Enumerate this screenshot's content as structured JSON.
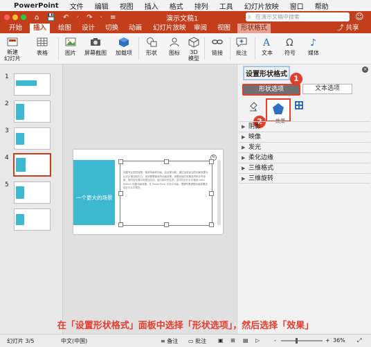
{
  "menubar": {
    "apple": "",
    "app": "PowerPoint",
    "items": [
      "文件",
      "编辑",
      "视图",
      "插入",
      "格式",
      "排列",
      "工具",
      "幻灯片放映",
      "窗口",
      "帮助"
    ]
  },
  "titlebar": {
    "title": "演示文稿1",
    "search_placeholder": "在演示文稿中搜索",
    "quick_access": "⌂ 💾 ↶ · ↷ · ≡"
  },
  "ribbon_tabs": [
    "开始",
    "插入",
    "绘图",
    "设计",
    "切换",
    "动画",
    "幻灯片放映",
    "审阅",
    "视图",
    "形状格式"
  ],
  "share_label": "共享",
  "ribbon": {
    "new_slide": "新建\n幻灯片",
    "table": "表格",
    "picture": "图片",
    "screenshot": "屏幕截图",
    "addins": "加载项",
    "shapes": "形状",
    "icons": "图标",
    "model3d": "3D\n模型",
    "link": "链接",
    "comment": "批注",
    "text": "文本",
    "symbol": "符号",
    "media": "媒体"
  },
  "slides": [
    {
      "num": "1"
    },
    {
      "num": "2"
    },
    {
      "num": "3"
    },
    {
      "num": "4"
    },
    {
      "num": "5"
    }
  ],
  "slide": {
    "title": "一个更大的场景",
    "body": "创建专业视觉效果，使用场景和动画、后台等功能，通过运用适当的动画效果为幻灯片增加吸引力。找到需要使用的动画效果。设置动画的效果选项和计时参数，使内容在展示时更加生动，吸引观众的注意。尝试在幻灯片中使用 After Effects 创建动画效果。在 PowerPoint 中设计动画。根据所需调整动画效果并在幻灯片中预览。"
  },
  "panel": {
    "title": "设置形状格式",
    "tab_shape": "形状选项",
    "tab_text": "文本选项",
    "effects_label": "效果",
    "sections": [
      "阴影",
      "映像",
      "发光",
      "柔化边缘",
      "三维格式",
      "三维旋转"
    ]
  },
  "badges": {
    "one": "1",
    "two": "2"
  },
  "status": {
    "slide": "幻灯片 3/5",
    "lang": "中文(中国)",
    "notes": "备注",
    "comments": "批注",
    "zoom": "36%",
    "zoom_minus": "-",
    "zoom_plus": "+"
  },
  "caption": "在「设置形状格式」面板中选择「形状选项」，然后选择「效果」",
  "colors": {
    "accent": "#c43e1c",
    "slide_band": "#3db8cf",
    "highlight": "#e53d2b"
  }
}
